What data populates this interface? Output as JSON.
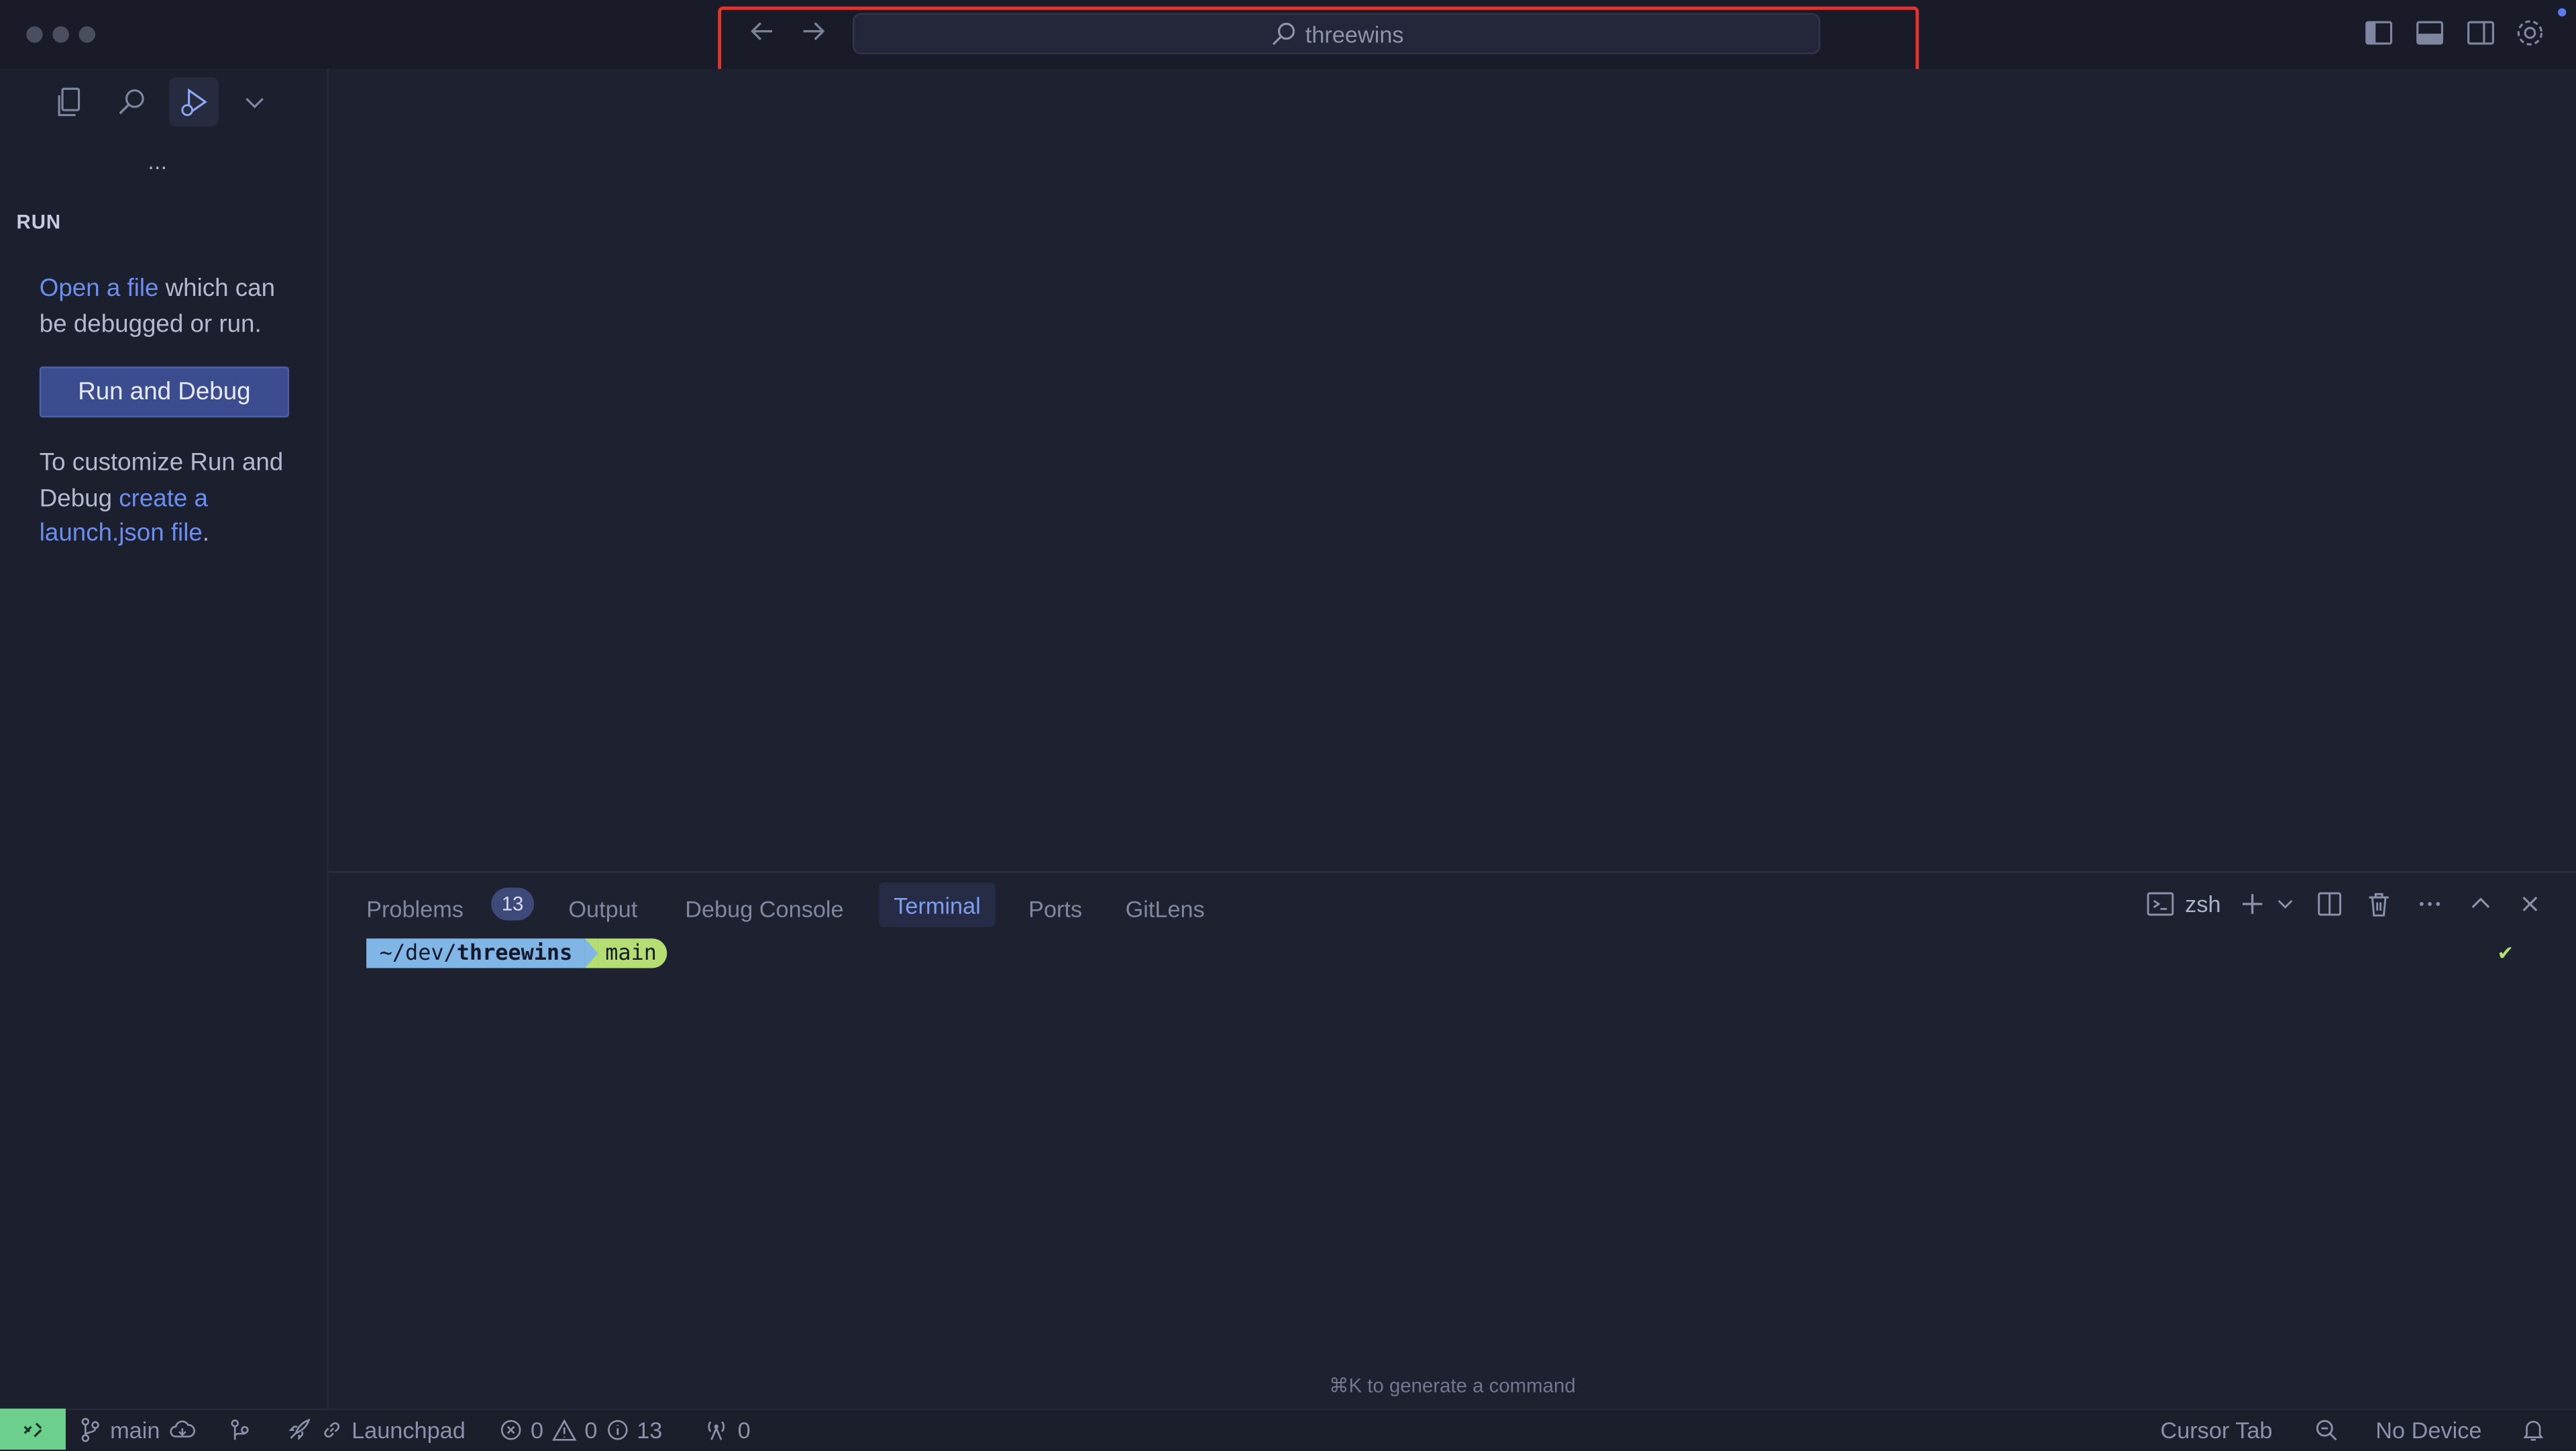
{
  "titlebar": {
    "search_text": "threewins"
  },
  "sidebar": {
    "section_title": "RUN",
    "more_label": "...",
    "open_link": "Open a file",
    "open_rest": " which can be debugged or run.",
    "run_button": "Run and Debug",
    "customize_text": "To customize Run and Debug ",
    "launch_link": "create a launch.json file",
    "period": "."
  },
  "panel": {
    "tabs": [
      {
        "label": "Problems",
        "badge": "13"
      },
      {
        "label": "Output"
      },
      {
        "label": "Debug Console"
      },
      {
        "label": "Terminal",
        "active": true
      },
      {
        "label": "Ports"
      },
      {
        "label": "GitLens"
      }
    ],
    "shell_label": "zsh",
    "terminal": {
      "dir_prefix": "~/dev/",
      "dir_name": "threewins",
      "branch": "main",
      "check": "✔"
    },
    "generate_hint": "⌘K to generate a command"
  },
  "statusbar": {
    "branch": "main",
    "launchpad": "Launchpad",
    "errors": "0",
    "warnings": "0",
    "info": "13",
    "ports": "0",
    "cursor_tab": "Cursor Tab",
    "device": "No Device"
  },
  "colors": {
    "accent": "#6b8ff0",
    "button_bg": "#3c4d8f",
    "remote_bg": "#6ccf8c",
    "highlight_border": "#e0352b",
    "prompt_dir_bg": "#7fb6e6",
    "prompt_branch_bg": "#b5de72"
  }
}
